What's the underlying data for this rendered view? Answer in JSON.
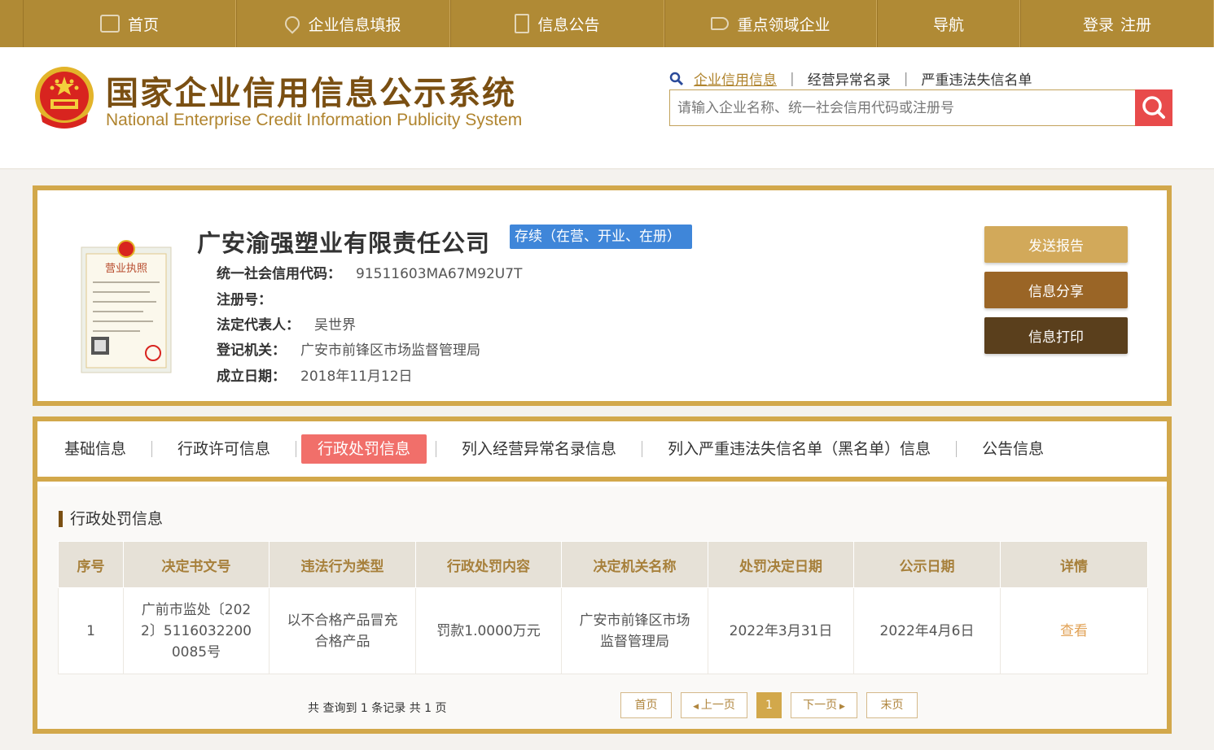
{
  "nav": {
    "items": [
      {
        "icon": "monitor-icon",
        "label": "首页"
      },
      {
        "icon": "pen-icon",
        "label": "企业信息填报"
      },
      {
        "icon": "document-icon",
        "label": "信息公告"
      },
      {
        "icon": "speaker-icon",
        "label": "重点领域企业"
      },
      {
        "icon": "",
        "label": "导航"
      }
    ],
    "login": "登录",
    "register": "注册"
  },
  "header": {
    "title": "国家企业信用信息公示系统",
    "subtitle": "National Enterprise Credit Information Publicity System",
    "search_tabs": [
      "企业信用信息",
      "经营异常名录",
      "严重违法失信名单"
    ],
    "search_placeholder": "请输入企业名称、统一社会信用代码或注册号"
  },
  "company": {
    "name": "广安渝强塑业有限责任公司",
    "status": "存续（在营、开业、在册）",
    "fields": [
      {
        "label": "统一社会信用代码：",
        "value": "91511603MA67M92U7T"
      },
      {
        "label": "注册号：",
        "value": ""
      },
      {
        "label": "法定代表人：",
        "value": "吴世界"
      },
      {
        "label": "登记机关：",
        "value": "广安市前锋区市场监督管理局"
      },
      {
        "label": "成立日期：",
        "value": "2018年11月12日"
      }
    ],
    "license_caption": "营业执照",
    "actions": {
      "send_report": "发送报告",
      "share": "信息分享",
      "print": "信息打印"
    }
  },
  "tabs": {
    "items": [
      "基础信息",
      "行政许可信息",
      "行政处罚信息",
      "列入经营异常名录信息",
      "列入严重违法失信名单（黑名单）信息",
      "公告信息"
    ],
    "active_index": 2
  },
  "penalty": {
    "section_title": "行政处罚信息",
    "columns": [
      "序号",
      "决定书文号",
      "违法行为类型",
      "行政处罚内容",
      "决定机关名称",
      "处罚决定日期",
      "公示日期",
      "详情"
    ],
    "rows": [
      [
        "1",
        "广前市监处〔2022〕51160322000085号",
        "以不合格产品冒充合格产品",
        "罚款1.0000万元",
        "广安市前锋区市场监督管理局",
        "2022年3月31日",
        "2022年4月6日",
        "查看"
      ]
    ],
    "summary": "共 查询到 1 条记录 共 1 页",
    "pagination": {
      "first": "首页",
      "prev": "上一页",
      "current": "1",
      "next": "下一页",
      "last": "末页"
    }
  },
  "colors": {
    "gold": "#b08a35",
    "accent_red": "#f16f6a",
    "brown": "#7a4f12",
    "blue_badge": "#3f86d9"
  }
}
